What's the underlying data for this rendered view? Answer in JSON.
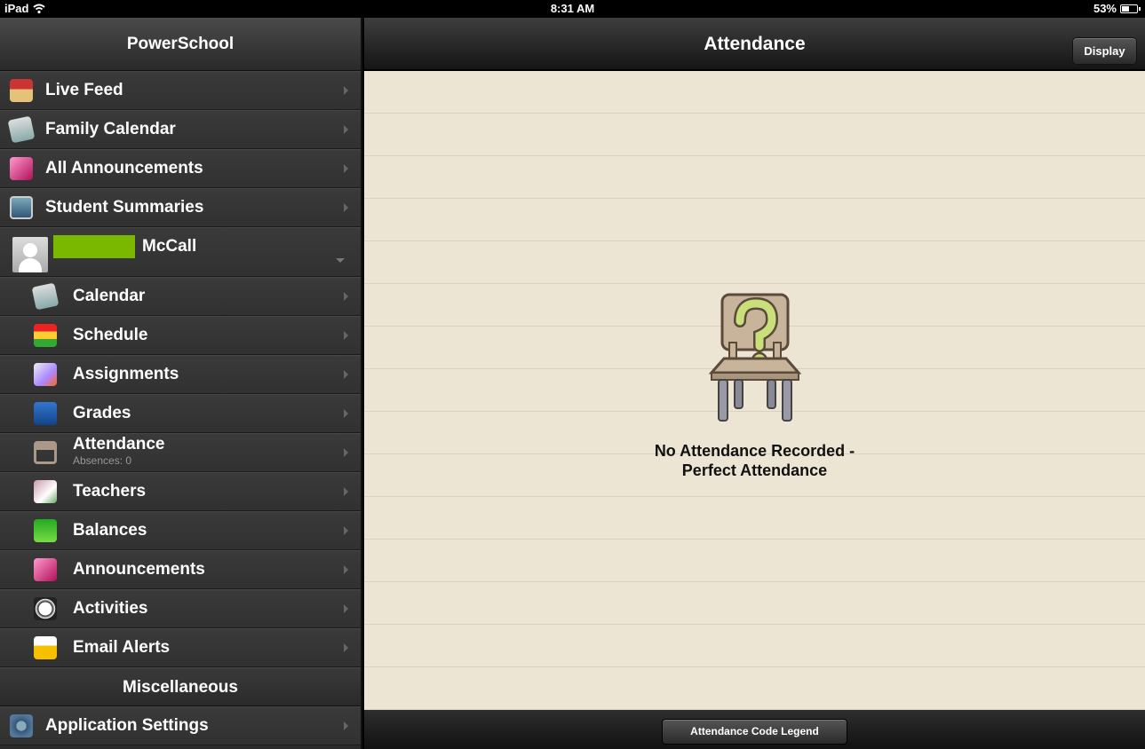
{
  "status_bar": {
    "device": "iPad",
    "time": "8:31 AM",
    "battery_percent": "53%",
    "battery_level": 0.53
  },
  "sidebar": {
    "title": "PowerSchool",
    "top_items": [
      {
        "label": "Live Feed",
        "icon": "schoolhouse-icon"
      },
      {
        "label": "Family Calendar",
        "icon": "calendar-icon"
      },
      {
        "label": "All Announcements",
        "icon": "megaphone-icon"
      },
      {
        "label": "Student Summaries",
        "icon": "student-portrait-icon"
      }
    ],
    "student": {
      "name": "McCall"
    },
    "student_items": [
      {
        "label": "Calendar",
        "icon": "calendar-icon"
      },
      {
        "label": "Schedule",
        "icon": "books-icon"
      },
      {
        "label": "Assignments",
        "icon": "assignment-icon"
      },
      {
        "label": "Grades",
        "icon": "gradebook-icon"
      },
      {
        "label": "Attendance",
        "subtitle": "Absences: 0",
        "icon": "chair-icon"
      },
      {
        "label": "Teachers",
        "icon": "teacher-icon"
      },
      {
        "label": "Balances",
        "icon": "money-icon"
      },
      {
        "label": "Announcements",
        "icon": "megaphone-icon"
      },
      {
        "label": "Activities",
        "icon": "soccer-ball-icon"
      },
      {
        "label": "Email Alerts",
        "icon": "envelope-icon"
      }
    ],
    "misc_section": "Miscellaneous",
    "misc_items": [
      {
        "label": "Application Settings",
        "icon": "gear-icon"
      }
    ]
  },
  "main": {
    "title": "Attendance",
    "display_button": "Display",
    "empty_message_line1": "No Attendance Recorded -",
    "empty_message_line2": "Perfect Attendance",
    "legend_button": "Attendance Code Legend"
  },
  "colors": {
    "sidebar_bg": "#2b2b2b",
    "paper_bg": "#ece5d4",
    "redaction": "#7ab800"
  }
}
